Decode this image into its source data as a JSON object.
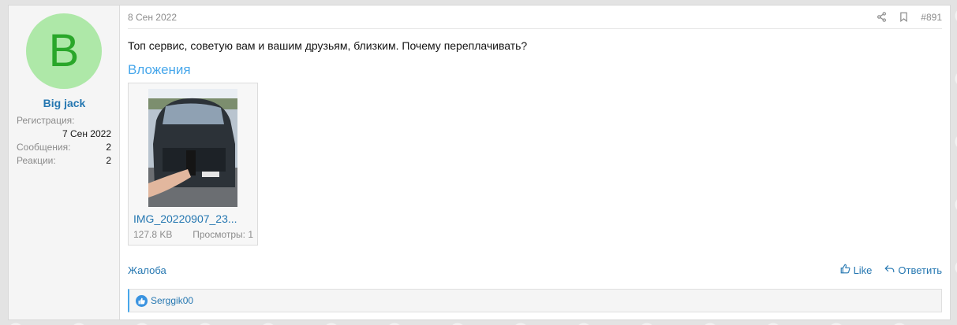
{
  "user": {
    "avatar_letter": "B",
    "name": "Big jack",
    "registration_label": "Регистрация:",
    "registration_date": "7 Сен 2022",
    "messages_label": "Сообщения:",
    "messages_count": "2",
    "reactions_label": "Реакции:",
    "reactions_count": "2"
  },
  "post": {
    "date": "8 Сен 2022",
    "number": "#891",
    "text": "Топ сервис, советую вам и вашим друзьям, близким. Почему переплачивать?",
    "attachments_title": "Вложения",
    "attachment": {
      "name": "IMG_20220907_23...",
      "size": "127.8 KB",
      "views": "Просмотры: 1"
    }
  },
  "actions": {
    "report": "Жалоба",
    "like": "Like",
    "reply": "Ответить"
  },
  "reactions": {
    "users": "Serggik00"
  },
  "icons": {
    "share": "share-icon",
    "bookmark": "bookmark-icon",
    "like": "thumbs-up-icon",
    "reply": "reply-icon"
  },
  "colors": {
    "link": "#2577b1",
    "accent": "#47a7eb",
    "avatar_bg": "#aee8a8",
    "avatar_fg": "#2aa72a"
  }
}
